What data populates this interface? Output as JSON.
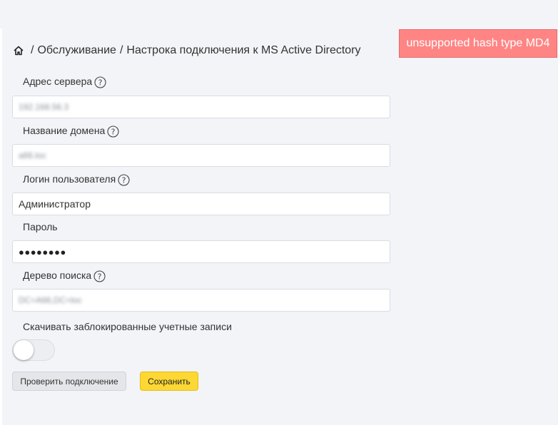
{
  "breadcrumb": {
    "icon": "home-icon",
    "sep1": "/",
    "section": "Обслуживание",
    "sep2": "/",
    "page": "Настрока подключения к MS Active Directory"
  },
  "alert": {
    "text": "unsupported hash type MD4",
    "color": "#ff8585"
  },
  "form": {
    "server": {
      "label": "Адрес сервера",
      "value": "192.168.56.3"
    },
    "domain": {
      "label": "Название домена",
      "value": "a66.loc"
    },
    "login": {
      "label": "Логин пользователя",
      "value": "Администратор"
    },
    "password": {
      "label": "Пароль",
      "value": "●●●●●●●●"
    },
    "search_tree": {
      "label": "Дерево поиска",
      "value": "DC=A66,DC=loc"
    },
    "blocked": {
      "label": "Скачивать заблокированные учетные записи",
      "enabled": false
    }
  },
  "buttons": {
    "check": "Проверить подключение",
    "save": "Сохранить",
    "save_color": "#fdd835"
  }
}
